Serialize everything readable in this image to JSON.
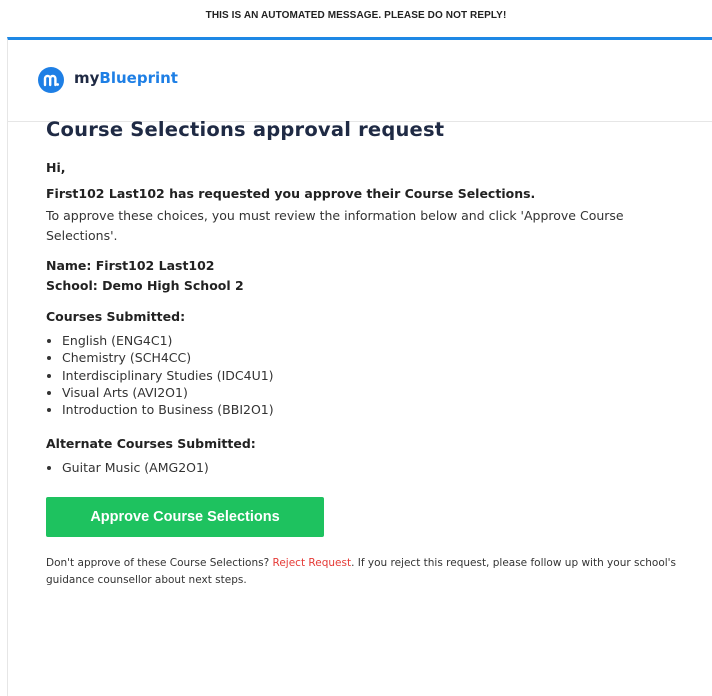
{
  "notice": "THIS IS AN AUTOMATED MESSAGE. PLEASE DO NOT REPLY!",
  "brand": {
    "prefix": "my",
    "name": "Blueprint",
    "accent": "#1e7fe5"
  },
  "email": {
    "title": "Course Selections approval request",
    "greeting": "Hi,",
    "request_line": "First102 Last102 has requested you approve their Course Selections.",
    "instructions": "To approve these choices, you must review the information below and click 'Approve Course Selections'.",
    "name_line": "Name: First102 Last102",
    "school_line": "School: Demo High School 2",
    "courses_heading": "Courses Submitted:",
    "courses": [
      "English (ENG4C1)",
      "Chemistry (SCH4CC)",
      "Interdisciplinary Studies (IDC4U1)",
      "Visual Arts (AVI2O1)",
      "Introduction to Business (BBI2O1)"
    ],
    "alternates_heading": "Alternate Courses Submitted:",
    "alternates": [
      "Guitar Music (AMG2O1)"
    ],
    "approve_button": "Approve Course Selections",
    "footer_before": "Don't approve of these Course Selections? ",
    "reject_link": "Reject Request",
    "footer_after": ". If you reject this request, please follow up with your school's guidance counsellor about next steps.",
    "approve_color": "#1ec25f",
    "reject_color": "#e53935"
  }
}
